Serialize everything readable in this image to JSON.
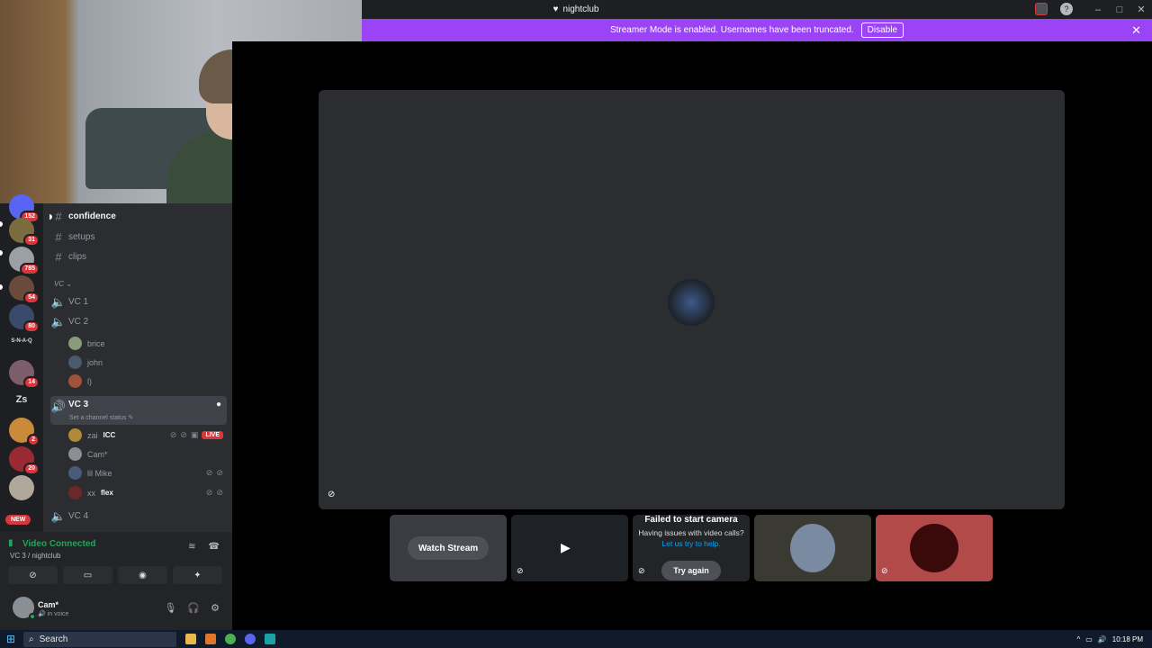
{
  "window": {
    "title": "nightclub"
  },
  "streamer_banner": {
    "text": "Streamer Mode is enabled. Usernames have been truncated.",
    "disable_label": "Disable",
    "color": "#9b44f5"
  },
  "guild_badges": [
    "152",
    "31",
    "785",
    "54",
    "80",
    "14",
    "2",
    "20"
  ],
  "guild_text": {
    "ssnaq": "S-N-A-Q",
    "zs": "Zs",
    "new": "NEW"
  },
  "channels": {
    "text": [
      "confidence",
      "setups",
      "clips"
    ],
    "category": "VC",
    "voice": [
      "VC 1",
      "VC 2",
      "VC 3",
      "VC 4"
    ],
    "vc2_members": [
      "brice",
      "john",
      "l)"
    ],
    "vc3_status": "Set a channel status",
    "vc3_members": [
      {
        "name": "zai",
        "tag": "ICC",
        "live": "LIVE"
      },
      {
        "name": "Cam*",
        "tag": ""
      },
      {
        "name": "lil Mike",
        "tag": ""
      },
      {
        "name": "xx",
        "tag": "flex"
      }
    ]
  },
  "voice_connection": {
    "status": "Video Connected",
    "location": "VC 3 / nightclub",
    "accent": "#23a559"
  },
  "user": {
    "name": "Cam*",
    "status": "in voice"
  },
  "stage": {
    "watch_stream": "Watch Stream",
    "fail_title": "Failed to start camera",
    "fail_sub": "Having issues with video calls?",
    "fail_link": "Let us try to help.",
    "try_again": "Try again"
  },
  "taskbar": {
    "search_placeholder": "Search",
    "time": "10:18 PM"
  }
}
